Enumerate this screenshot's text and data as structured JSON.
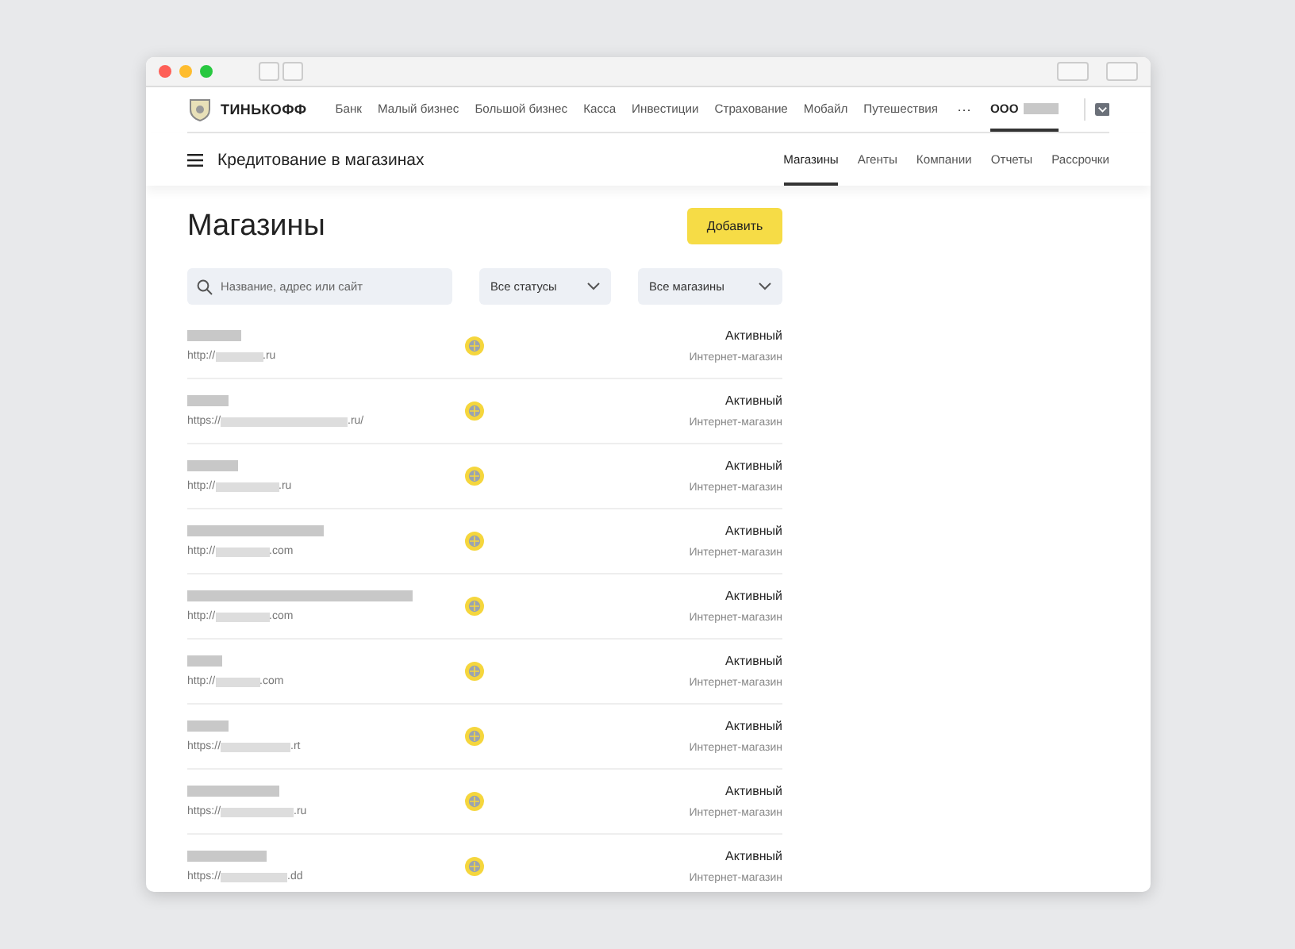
{
  "top_nav": {
    "brand": "ТИНЬКОФФ",
    "items": [
      {
        "label": "Банк",
        "selected": false
      },
      {
        "label": "Малый бизнес",
        "selected": false
      },
      {
        "label": "Большой бизнес",
        "selected": false
      },
      {
        "label": "Касса",
        "selected": false
      },
      {
        "label": "Инвестиции",
        "selected": false
      },
      {
        "label": "Страхование",
        "selected": false
      },
      {
        "label": "Мобайл",
        "selected": false
      },
      {
        "label": "Путешествия",
        "selected": false
      }
    ],
    "more": "···",
    "account": {
      "label": "ООО",
      "selected": true
    }
  },
  "section_nav": {
    "title": "Кредитование в магазинах",
    "tabs": [
      {
        "label": "Магазины",
        "selected": true
      },
      {
        "label": "Агенты",
        "selected": false
      },
      {
        "label": "Компании",
        "selected": false
      },
      {
        "label": "Отчеты",
        "selected": false
      },
      {
        "label": "Рассрочки",
        "selected": false
      }
    ]
  },
  "page": {
    "title": "Магазины",
    "add_button": "Добавить",
    "search": {
      "placeholder": "Название, адрес или сайт"
    },
    "filters": [
      {
        "value": "Все статусы"
      },
      {
        "value": "Все магазины"
      }
    ]
  },
  "stores": [
    {
      "url_prefix": "http://",
      "url_suffix": ".ru",
      "status": "Активный",
      "type": "Интернет-магазин"
    },
    {
      "url_prefix": "https://",
      "url_suffix": ".ru/",
      "status": "Активный",
      "type": "Интернет-магазин"
    },
    {
      "url_prefix": "http://",
      "url_suffix": ".ru",
      "status": "Активный",
      "type": "Интернет-магазин"
    },
    {
      "url_prefix": "http://",
      "url_suffix": ".com",
      "status": "Активный",
      "type": "Интернет-магазин"
    },
    {
      "url_prefix": "http://",
      "url_suffix": ".com",
      "status": "Активный",
      "type": "Интернет-магазин"
    },
    {
      "url_prefix": "http://",
      "url_suffix": ".com",
      "status": "Активный",
      "type": "Интернет-магазин"
    },
    {
      "url_prefix": "https://",
      "url_suffix": ".rt",
      "status": "Активный",
      "type": "Интернет-магазин"
    },
    {
      "url_prefix": "https://",
      "url_suffix": ".ru",
      "status": "Активный",
      "type": "Интернет-магазин"
    },
    {
      "url_prefix": "https://",
      "url_suffix": ".dd",
      "status": "Активный",
      "type": "Интернет-магазин"
    }
  ]
}
